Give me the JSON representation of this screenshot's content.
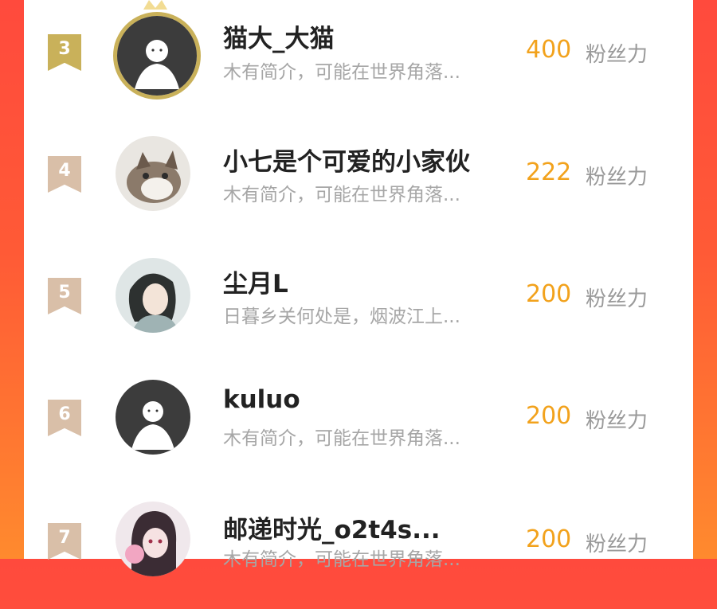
{
  "colors": {
    "accent_orange": "#f2a21c",
    "gold_badge": "#c9b15a",
    "bronze_badge": "#d9bfa8",
    "background_red": "#ff4a3d"
  },
  "ranking": [
    {
      "rank": "3",
      "name": "猫大_大猫",
      "bio": "木有简介，可能在世界角落...",
      "score": "400",
      "unit": "粉丝力",
      "avatar": "default-avatar-icon"
    },
    {
      "rank": "4",
      "name": "小七是个可爱的小家伙",
      "bio": "木有简介，可能在世界角落...",
      "score": "222",
      "unit": "粉丝力",
      "avatar": "cat-photo-avatar"
    },
    {
      "rank": "5",
      "name": "尘月L",
      "bio": "日暮乡关何处是，烟波江上...",
      "score": "200",
      "unit": "粉丝力",
      "avatar": "illustrated-character-avatar"
    },
    {
      "rank": "6",
      "name": "kuluo",
      "bio": "木有简介，可能在世界角落...",
      "score": "200",
      "unit": "粉丝力",
      "avatar": "default-avatar-icon"
    },
    {
      "rank": "7",
      "name": "邮递时光_o2t4s...",
      "bio": "木有简介，可能在世界角落...",
      "score": "200",
      "unit": "粉丝力",
      "avatar": "anime-girl-avatar"
    }
  ]
}
